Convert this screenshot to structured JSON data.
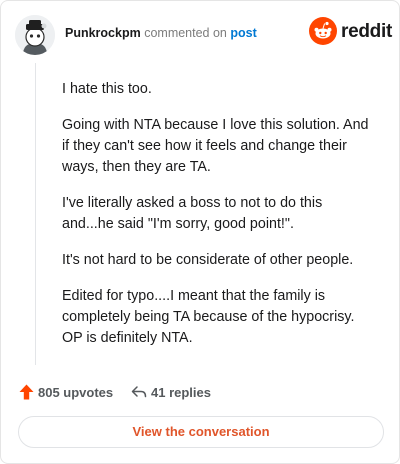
{
  "header": {
    "username": "Punkrockpm",
    "action_text": "commented on",
    "post_link": "post",
    "brand_name": "reddit"
  },
  "comment": {
    "paragraphs": [
      "I hate this too.",
      "Going with NTA because I love this solution. And if they can't see how it feels and change their ways, then they are TA.",
      "I've literally asked a boss to not to do this and...he said \"I'm sorry, good point!\".",
      "It's not hard to be considerate of other people.",
      "Edited for typo....I meant that the family is completely being TA because of the hypocrisy. OP is definitely NTA."
    ]
  },
  "footer": {
    "upvotes": "805 upvotes",
    "replies": "41 replies",
    "cta_label": "View the conversation"
  },
  "colors": {
    "reddit_orange": "#ff4500",
    "link_blue": "#0079d3",
    "cta_text": "#e0552a"
  }
}
